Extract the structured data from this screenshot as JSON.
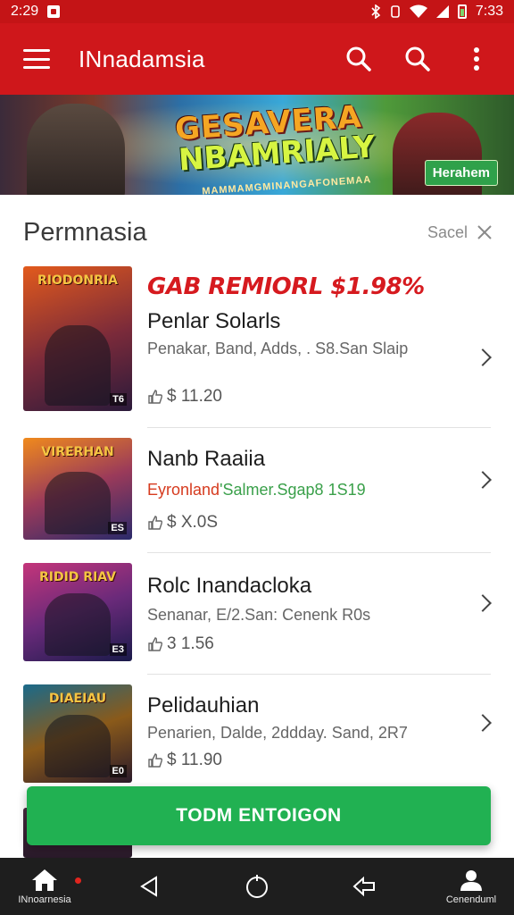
{
  "status_bar": {
    "time_left": "2:29",
    "time_right": "7:33"
  },
  "app_bar": {
    "title": "INnadamsia"
  },
  "banner": {
    "title_line1": "GESAVERA",
    "title_line2": "NBAMRIALY",
    "subtitle": "MAMMAMGMINANGAFONEMAA",
    "chip": "Herahem"
  },
  "section": {
    "title": "Permnasia",
    "sort_label": "Sacel"
  },
  "items": [
    {
      "thumb_title": "RIODONRIA",
      "thumb_rating": "Т6",
      "thumb_colors": [
        "#e25a1c",
        "#5a2a6a"
      ],
      "promo": "GAB REMIORL $1.98%",
      "name": "Penlar Solarls",
      "sub": "Penakar, Band, Adds, . S8.San Slaip",
      "price": "$ 11.20"
    },
    {
      "thumb_title": "VIRERHAN",
      "thumb_rating": "ES",
      "thumb_colors": [
        "#f08a1c",
        "#3a3a8a"
      ],
      "name": "Nanb Raaiia",
      "sub_accent": "Eyronland",
      "sub_green": "'Salmer.Sgap8  1S19",
      "price": "$ X.0S"
    },
    {
      "thumb_title": "RIDID RIAV",
      "thumb_rating": "E3",
      "thumb_colors": [
        "#c4357a",
        "#2a1a5a"
      ],
      "name": "Rolc Inandacloka",
      "sub": "Senanar, E/2.San: Cenenk R0s",
      "price": "3 1.56"
    },
    {
      "thumb_title": "DIAEIAU",
      "thumb_rating": "E0",
      "thumb_colors": [
        "#1a6a8a",
        "#e2a41c"
      ],
      "name": "Pelidauhian",
      "sub": "Penarien, Dalde, 2ddday. Sand, 2R7",
      "price": "$ 11.90"
    }
  ],
  "cta": {
    "label": "TODM ENTOIGON"
  },
  "nav": {
    "home_label": "INnoarnesia",
    "profile_label": "Cenenduml"
  },
  "colors": {
    "primary_red": "#cf171b",
    "cta_green": "#21b152",
    "promo_red": "#d61a1f"
  }
}
